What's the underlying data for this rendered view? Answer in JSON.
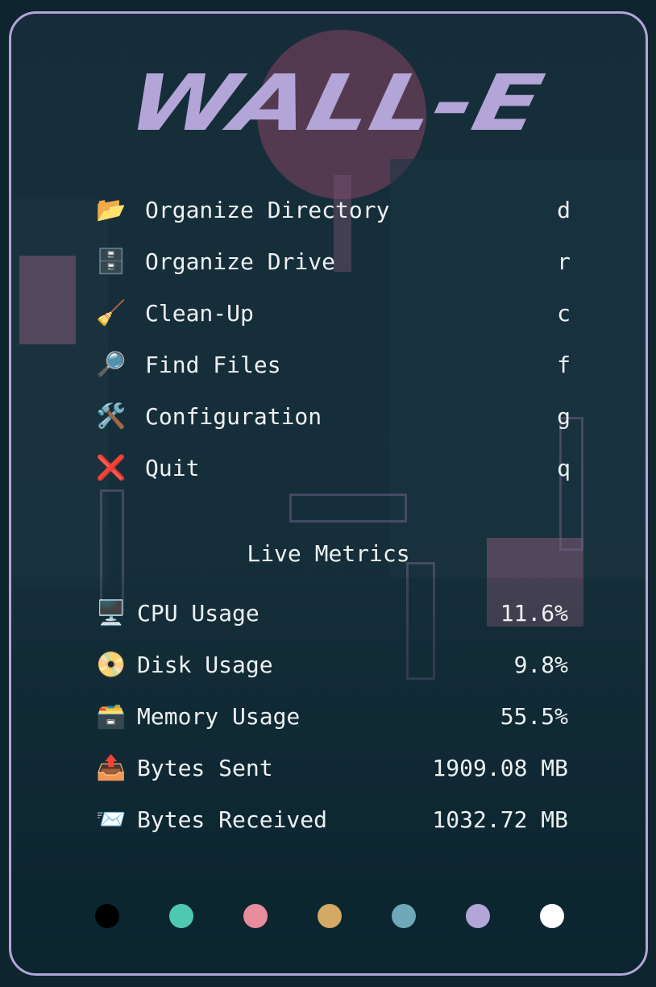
{
  "app": {
    "title": "WALL-E"
  },
  "menu": [
    {
      "icon": "open-folder-icon",
      "glyph": "📂",
      "label": "Organize Directory",
      "key": "d"
    },
    {
      "icon": "file-cabinet-icon",
      "glyph": "🗄️",
      "label": "Organize Drive",
      "key": "r"
    },
    {
      "icon": "broom-icon",
      "glyph": "🧹",
      "label": "Clean-Up",
      "key": "c"
    },
    {
      "icon": "magnifier-icon",
      "glyph": "🔎",
      "label": "Find Files",
      "key": "f"
    },
    {
      "icon": "tools-icon",
      "glyph": "🛠️",
      "label": "Configuration",
      "key": "g"
    },
    {
      "icon": "cross-mark-icon",
      "glyph": "❌",
      "label": "Quit",
      "key": "q"
    }
  ],
  "metrics": {
    "title": "Live Metrics",
    "items": [
      {
        "icon": "monitor-icon",
        "glyph": "🖥️",
        "label": "CPU Usage",
        "value": "11.6%"
      },
      {
        "icon": "dvd-icon",
        "glyph": "📀",
        "label": "Disk Usage",
        "value": "9.8%"
      },
      {
        "icon": "card-file-box-icon",
        "glyph": "🗃️",
        "label": "Memory Usage",
        "value": "55.5%"
      },
      {
        "icon": "outbox-tray-icon",
        "glyph": "📤",
        "label": "Bytes Sent",
        "value": "1909.08 MB"
      },
      {
        "icon": "incoming-envelope-icon",
        "glyph": "📨",
        "label": "Bytes Received",
        "value": "1032.72 MB"
      }
    ]
  },
  "palette": [
    "#000000",
    "#4ec9b0",
    "#e88d9d",
    "#d4a964",
    "#6fa8b8",
    "#b3a5d8",
    "#ffffff"
  ],
  "colors": {
    "accent": "#b3a5d8",
    "text": "#eef0f2",
    "background": "#17303c"
  }
}
